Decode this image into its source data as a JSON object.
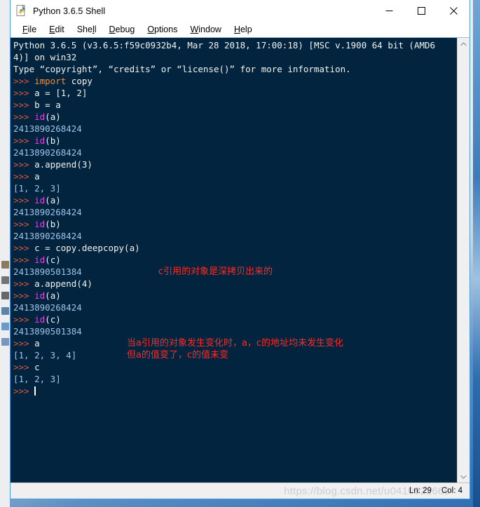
{
  "window": {
    "title": "Python 3.6.5 Shell",
    "icon": "python-idle-icon",
    "minimize_label": "─",
    "maximize_label": "☐",
    "close_label": "✕"
  },
  "menubar": {
    "items": [
      {
        "label": "File",
        "pre": "",
        "accel": "F",
        "post": "ile"
      },
      {
        "label": "Edit",
        "pre": "",
        "accel": "E",
        "post": "dit"
      },
      {
        "label": "Shell",
        "pre": "She",
        "accel": "l",
        "post": "l"
      },
      {
        "label": "Debug",
        "pre": "",
        "accel": "D",
        "post": "ebug"
      },
      {
        "label": "Options",
        "pre": "",
        "accel": "O",
        "post": "ptions"
      },
      {
        "label": "Window",
        "pre": "",
        "accel": "W",
        "post": "indow"
      },
      {
        "label": "Help",
        "pre": "",
        "accel": "H",
        "post": "elp"
      }
    ]
  },
  "console": {
    "background": "#02243f",
    "colors": {
      "prompt": "#e0563a",
      "keyword": "#ff8c26",
      "builtin": "#e83ee8",
      "output": "#9fc4e8",
      "plain": "#f2f4f0",
      "annotation": "#ff2a22"
    },
    "lines": [
      [
        {
          "t": "plain",
          "s": "Python 3.6.5 (v3.6.5:f59c0932b4, Mar 28 2018, 17:00:18) [MSC v.1900 64 bit (AMD6"
        }
      ],
      [
        {
          "t": "plain",
          "s": "4)] on win32"
        }
      ],
      [
        {
          "t": "plain",
          "s": "Type “copyright”, “credits” or “license()” for more information."
        }
      ],
      [
        {
          "t": "prompt",
          "s": ">>> "
        },
        {
          "t": "kw",
          "s": "import"
        },
        {
          "t": "plain",
          "s": " copy"
        }
      ],
      [
        {
          "t": "prompt",
          "s": ">>> "
        },
        {
          "t": "plain",
          "s": "a = [1, 2]"
        }
      ],
      [
        {
          "t": "prompt",
          "s": ">>> "
        },
        {
          "t": "plain",
          "s": "b = a"
        }
      ],
      [
        {
          "t": "prompt",
          "s": ">>> "
        },
        {
          "t": "builtin",
          "s": "id"
        },
        {
          "t": "plain",
          "s": "(a)"
        }
      ],
      [
        {
          "t": "out",
          "s": "2413890268424"
        }
      ],
      [
        {
          "t": "prompt",
          "s": ">>> "
        },
        {
          "t": "builtin",
          "s": "id"
        },
        {
          "t": "plain",
          "s": "(b)"
        }
      ],
      [
        {
          "t": "out",
          "s": "2413890268424"
        }
      ],
      [
        {
          "t": "prompt",
          "s": ">>> "
        },
        {
          "t": "plain",
          "s": "a.append(3)"
        }
      ],
      [
        {
          "t": "prompt",
          "s": ">>> "
        },
        {
          "t": "plain",
          "s": "a"
        }
      ],
      [
        {
          "t": "out",
          "s": "[1, 2, 3]"
        }
      ],
      [
        {
          "t": "prompt",
          "s": ">>> "
        },
        {
          "t": "builtin",
          "s": "id"
        },
        {
          "t": "plain",
          "s": "(a)"
        }
      ],
      [
        {
          "t": "out",
          "s": "2413890268424"
        }
      ],
      [
        {
          "t": "prompt",
          "s": ">>> "
        },
        {
          "t": "builtin",
          "s": "id"
        },
        {
          "t": "plain",
          "s": "(b)"
        }
      ],
      [
        {
          "t": "out",
          "s": "2413890268424"
        }
      ],
      [
        {
          "t": "prompt",
          "s": ">>> "
        },
        {
          "t": "plain",
          "s": "c = copy.deepcopy(a)"
        }
      ],
      [
        {
          "t": "prompt",
          "s": ">>> "
        },
        {
          "t": "builtin",
          "s": "id"
        },
        {
          "t": "plain",
          "s": "(c)"
        }
      ],
      [
        {
          "t": "out",
          "s": "2413890501384"
        }
      ],
      [
        {
          "t": "prompt",
          "s": ">>> "
        },
        {
          "t": "plain",
          "s": "a.append(4)"
        }
      ],
      [
        {
          "t": "prompt",
          "s": ">>> "
        },
        {
          "t": "builtin",
          "s": "id"
        },
        {
          "t": "plain",
          "s": "(a)"
        }
      ],
      [
        {
          "t": "out",
          "s": "2413890268424"
        }
      ],
      [
        {
          "t": "prompt",
          "s": ">>> "
        },
        {
          "t": "builtin",
          "s": "id"
        },
        {
          "t": "plain",
          "s": "(c)"
        }
      ],
      [
        {
          "t": "out",
          "s": "2413890501384"
        }
      ],
      [
        {
          "t": "prompt",
          "s": ">>> "
        },
        {
          "t": "plain",
          "s": "a"
        }
      ],
      [
        {
          "t": "out",
          "s": "[1, 2, 3, 4]"
        }
      ],
      [
        {
          "t": "prompt",
          "s": ">>> "
        },
        {
          "t": "plain",
          "s": "c"
        }
      ],
      [
        {
          "t": "out",
          "s": "[1, 2, 3]"
        }
      ],
      [
        {
          "t": "prompt",
          "s": ">>> "
        },
        {
          "t": "caret",
          "s": ""
        }
      ]
    ],
    "annotations": [
      {
        "name": "annotation-deepcopy",
        "text": "c引用的对象是深拷贝出来的"
      },
      {
        "name": "annotation-address",
        "text": "当a引用的对象发生变化时，a，c的地址均未发生变化\n但a的值变了，c的值未变"
      }
    ]
  },
  "scrollbar": {
    "up_arrow": "▲",
    "down_arrow": "▼"
  },
  "statusbar": {
    "line_label": "Ln: 29",
    "col_label": "Col: 4",
    "watermark": "https://blog.csdn.net/u0410921666"
  }
}
